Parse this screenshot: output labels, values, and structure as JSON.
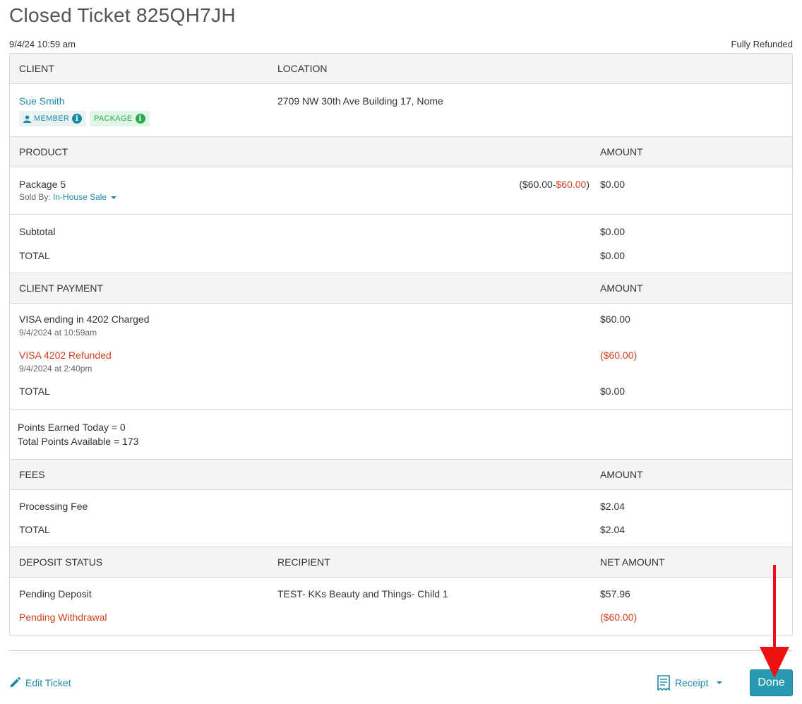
{
  "page": {
    "title": "Closed Ticket 825QH7JH",
    "date": "9/4/24 10:59 am",
    "status": "Fully Refunded"
  },
  "client_section": {
    "header_client": "CLIENT",
    "header_location": "LOCATION",
    "client_name": "Sue Smith",
    "badge_member": "MEMBER",
    "badge_package": "PACKAGE",
    "info_glyph": "i",
    "location": "2709 NW 30th Ave Building 17, Nome"
  },
  "product_section": {
    "header_product": "PRODUCT",
    "header_amount": "AMOUNT",
    "item_name": "Package 5",
    "sold_by_label": "Sold By:",
    "sold_by_value": "In-House Sale",
    "price_open": "(",
    "price_original": "$60.00",
    "price_sep": "-",
    "price_discount": "$60.00",
    "price_close": ")",
    "item_amount": "$0.00",
    "subtotal_label": "Subtotal",
    "subtotal_value": "$0.00",
    "total_label": "TOTAL",
    "total_value": "$0.00"
  },
  "payment_section": {
    "header_payment": "CLIENT PAYMENT",
    "header_amount": "AMOUNT",
    "charge_label": "VISA ending in 4202 Charged",
    "charge_date": "9/4/2024 at 10:59am",
    "charge_amount": "$60.00",
    "refund_label": "VISA 4202 Refunded",
    "refund_date": "9/4/2024 at 2:40pm",
    "refund_amount": "($60.00)",
    "total_label": "TOTAL",
    "total_value": "$0.00"
  },
  "points_section": {
    "earned": "Points Earned Today = 0",
    "available": "Total Points Available = 173"
  },
  "fees_section": {
    "header_fees": "FEES",
    "header_amount": "AMOUNT",
    "fee_label": "Processing Fee",
    "fee_value": "$2.04",
    "total_label": "TOTAL",
    "total_value": "$2.04"
  },
  "deposit_section": {
    "header_status": "DEPOSIT STATUS",
    "header_recipient": "RECIPIENT",
    "header_net": "NET AMOUNT",
    "deposit_label": "Pending Deposit",
    "deposit_recipient": "TEST- KKs Beauty and Things- Child 1",
    "deposit_amount": "$57.96",
    "withdrawal_label": "Pending Withdrawal",
    "withdrawal_amount": "($60.00)"
  },
  "footer": {
    "edit_label": "Edit Ticket",
    "receipt_label": "Receipt",
    "done_label": "Done"
  },
  "colors": {
    "link": "#1b8ba8",
    "refund_red": "#d3401f",
    "done_button": "#2a9ab3",
    "annotation_arrow": "#ee1111"
  },
  "icons": [
    "user-icon",
    "info-icon",
    "caret-down-icon",
    "pencil-icon",
    "receipt-icon",
    "annotation-arrow"
  ]
}
